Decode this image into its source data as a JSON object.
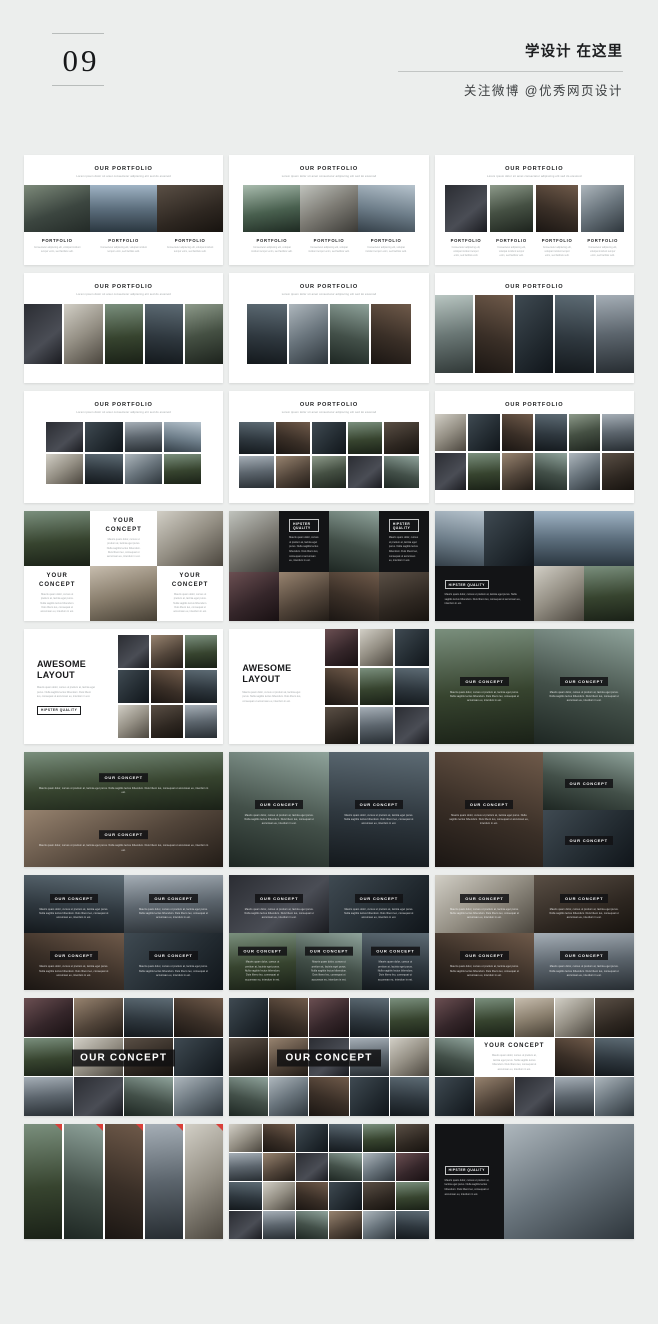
{
  "header": {
    "page_number": "09",
    "brand_title": "学设计 在这里",
    "brand_sub": "关注微博 @优秀网页设计"
  },
  "labels": {
    "our_portfolio": "OUR PORTFOLIO",
    "portfolio": "PORTFOLIO",
    "your_concept_line1": "YOUR",
    "your_concept_line2": "CONCEPT",
    "your_concept": "YOUR CONCEPT",
    "our_concept": "OUR CONCEPT",
    "awesome_line1": "AWESOME",
    "awesome_line2": "LAYOUT",
    "hipster_quality": "HIPSTER QUALITY",
    "lorem_sub": "Lorem ipsum dolor sit amet consectetur adipiscing elit sed do eiusmod",
    "lorem_cap": "Consectetur adipiscing elit, volutpat incidunt tempor enim, sed facilisis velit.",
    "lorem_body": "Mauris quam dolor, cursus ut pretium at, lacinia eget purus. Nulla sagittis lectus bibendum. Duis libero leo, consequat ut accumsan eu, interdum in est.",
    "lorem_overlay": "Mauris quam dolor, cursus ut pretium at, lacinia eget purus. Nulla sagittis lectus bibendum. Duis libero leo, consequat ut accumsan eu, interdum in est."
  },
  "colors": {
    "page_bg": "#eceeed",
    "slide_bg": "#ffffff",
    "ink": "#17181a",
    "muted": "#a3a8aa",
    "dark_panel": "#131416",
    "accent_red": "#d8403a"
  }
}
